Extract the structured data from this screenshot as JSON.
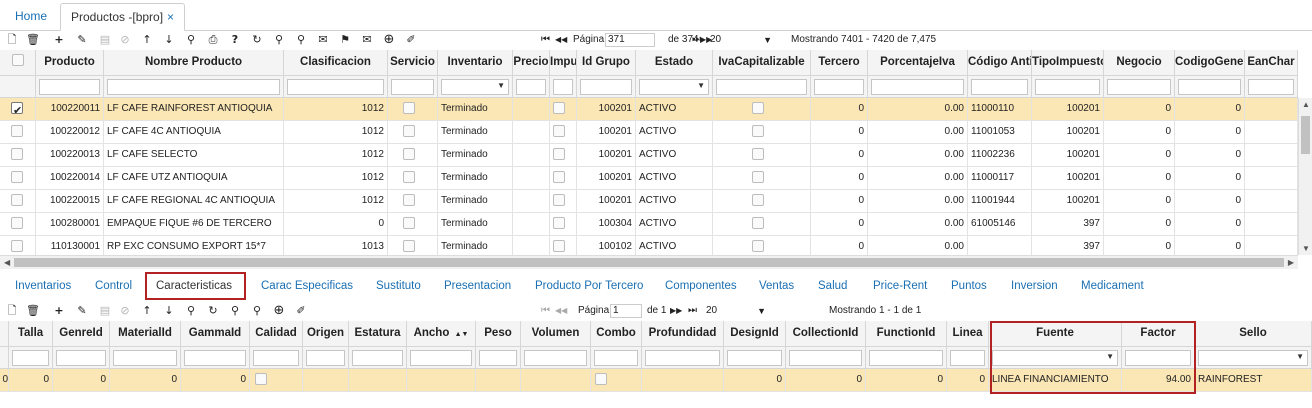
{
  "tabs": [
    {
      "label": "Home"
    },
    {
      "label": "Productos -[bpro]",
      "close": "×"
    }
  ],
  "top_toolbar": {
    "icons": [
      "new-doc-icon",
      "delete-icon",
      "add-icon",
      "edit-icon",
      "save-icon",
      "cancel-icon",
      "sort-up-icon",
      "sort-down-icon",
      "search-icon",
      "print-icon",
      "help-icon",
      "refresh-icon",
      "zoom-icon",
      "comment-icon",
      "pin-icon",
      "mail-icon",
      "add-circle-icon",
      "pencil-slash-icon"
    ],
    "pager": {
      "first": "⏮",
      "prev": "◀◀",
      "page_label": "Página",
      "page_value": "371",
      "of_label": "de 374",
      "next": "▶▶",
      "last": "⏭",
      "page_size": "20",
      "showing": "Mostrando 7401 - 7420 de 7,475"
    }
  },
  "main_grid": {
    "columns": [
      "Producto",
      "Nombre Producto",
      "Clasificacion",
      "Servicio",
      "Inventario",
      "Precio",
      "Impu",
      "Id Grupo",
      "Estado",
      "IvaCapitalizable",
      "Tercero",
      "PorcentajeIva",
      "Código Anti",
      "TipoImpuesto",
      "Negocio",
      "CodigoGener",
      "EanChar"
    ],
    "rows": [
      {
        "producto": "100220011",
        "nombre": "LF CAFE RAINFOREST ANTIOQUIA",
        "clasificacion": "1012",
        "inventario": "Terminado",
        "grupo": "100201",
        "estado": "ACTIVO",
        "tercero": "0",
        "iva": "0.00",
        "codigo": "11000110",
        "tipo": "100201",
        "negocio": "0",
        "codgen": "0"
      },
      {
        "producto": "100220012",
        "nombre": "LF CAFE 4C ANTIOQUIA",
        "clasificacion": "1012",
        "inventario": "Terminado",
        "grupo": "100201",
        "estado": "ACTIVO",
        "tercero": "0",
        "iva": "0.00",
        "codigo": "11001053",
        "tipo": "100201",
        "negocio": "0",
        "codgen": "0"
      },
      {
        "producto": "100220013",
        "nombre": "LF CAFE SELECTO",
        "clasificacion": "1012",
        "inventario": "Terminado",
        "grupo": "100201",
        "estado": "ACTIVO",
        "tercero": "0",
        "iva": "0.00",
        "codigo": "11002236",
        "tipo": "100201",
        "negocio": "0",
        "codgen": "0"
      },
      {
        "producto": "100220014",
        "nombre": "LF CAFE UTZ ANTIOQUIA",
        "clasificacion": "1012",
        "inventario": "Terminado",
        "grupo": "100201",
        "estado": "ACTIVO",
        "tercero": "0",
        "iva": "0.00",
        "codigo": "11000117",
        "tipo": "100201",
        "negocio": "0",
        "codgen": "0"
      },
      {
        "producto": "100220015",
        "nombre": "LF CAFE REGIONAL 4C ANTIOQUIA",
        "clasificacion": "1012",
        "inventario": "Terminado",
        "grupo": "100201",
        "estado": "ACTIVO",
        "tercero": "0",
        "iva": "0.00",
        "codigo": "11001944",
        "tipo": "100201",
        "negocio": "0",
        "codgen": "0"
      },
      {
        "producto": "100280001",
        "nombre": "EMPAQUE FIQUE #6 DE TERCERO",
        "clasificacion": "0",
        "inventario": "Terminado",
        "grupo": "100304",
        "estado": "ACTIVO",
        "tercero": "0",
        "iva": "0.00",
        "codigo": "61005146",
        "tipo": "397",
        "negocio": "0",
        "codgen": "0"
      },
      {
        "producto": "110130001",
        "nombre": "RP EXC CONSUMO EXPORT 15*7",
        "clasificacion": "1013",
        "inventario": "Terminado",
        "grupo": "100102",
        "estado": "ACTIVO",
        "tercero": "0",
        "iva": "0.00",
        "codigo": "",
        "tipo": "397",
        "negocio": "0",
        "codgen": "0"
      }
    ]
  },
  "detail_tabs": [
    "Inventarios",
    "Control",
    "Caracteristicas",
    "Carac Especificas",
    "Sustituto",
    "Presentacion",
    "Producto Por Tercero",
    "Componentes",
    "Ventas",
    "Salud",
    "Price-Rent",
    "Puntos",
    "Inversion",
    "Medicament"
  ],
  "bottom_toolbar": {
    "pager": {
      "page_label": "Página",
      "page_value": "1",
      "of_label": "de 1",
      "page_size": "20",
      "showing": "Mostrando 1 - 1 de 1"
    }
  },
  "detail_grid": {
    "columns": [
      "Talla",
      "GenreId",
      "MaterialId",
      "GammaId",
      "Calidad",
      "Origen",
      "Estatura",
      "Ancho",
      "Peso",
      "Volumen",
      "Combo",
      "Profundidad",
      "DesignId",
      "CollectionId",
      "FunctionId",
      "Linea",
      "Fuente",
      "Factor",
      "Sello"
    ],
    "sort_indicator": "▲▼",
    "row": {
      "c0": "0",
      "talla": "0",
      "genre": "0",
      "material": "0",
      "gamma": "0",
      "design": "0",
      "collection": "0",
      "function": "0",
      "linea": "0",
      "fuente": "LINEA FINANCIAMIENTO",
      "factor": "94.00",
      "sello": "RAINFOREST"
    }
  },
  "colors": {
    "selected_row": "#fbe7b6",
    "link": "#1a6fb3",
    "highlight_box": "#b22222"
  }
}
